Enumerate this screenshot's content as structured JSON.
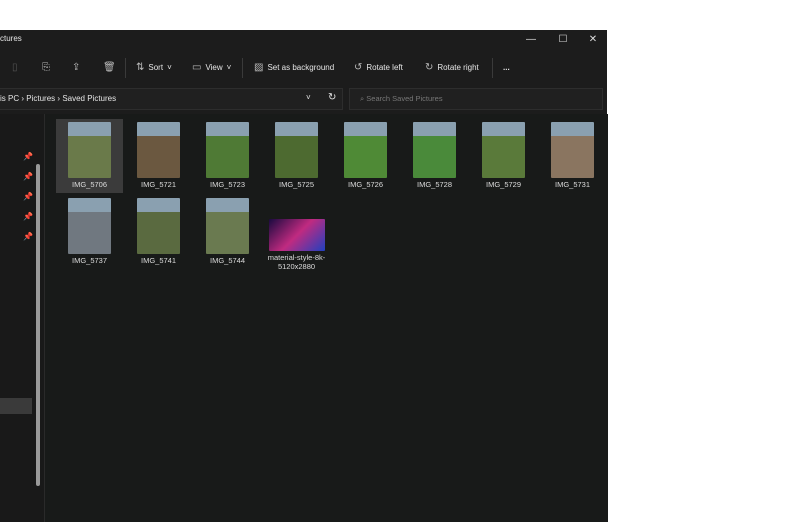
{
  "window": {
    "title": "ctures"
  },
  "toolbar": {
    "sort": "Sort",
    "view": "View",
    "set_bg": "Set as background",
    "rotate_left": "Rotate left",
    "rotate_right": "Rotate right",
    "more": "..."
  },
  "address": {
    "segments": [
      "is PC",
      "Pictures",
      "Saved Pictures"
    ],
    "sep": "›"
  },
  "search": {
    "placeholder": "Search Saved Pictures"
  },
  "files": [
    {
      "name": "IMG_5706",
      "color": "#6a7a4a"
    },
    {
      "name": "IMG_5721",
      "color": "#6b5840"
    },
    {
      "name": "IMG_5723",
      "color": "#4f7a35"
    },
    {
      "name": "IMG_5725",
      "color": "#4d6a30"
    },
    {
      "name": "IMG_5726",
      "color": "#4f8a36"
    },
    {
      "name": "IMG_5728",
      "color": "#4a8a3a"
    },
    {
      "name": "IMG_5729",
      "color": "#5a7a3a"
    },
    {
      "name": "IMG_5731",
      "color": "#8a7560"
    },
    {
      "name": "IMG_5737",
      "color": "#707880"
    },
    {
      "name": "IMG_5741",
      "color": "#5a6a40"
    },
    {
      "name": "IMG_5744",
      "color": "#6a7a50"
    },
    {
      "name": "material-style-8k-5120x2880",
      "color": "#2a1a6a"
    }
  ]
}
